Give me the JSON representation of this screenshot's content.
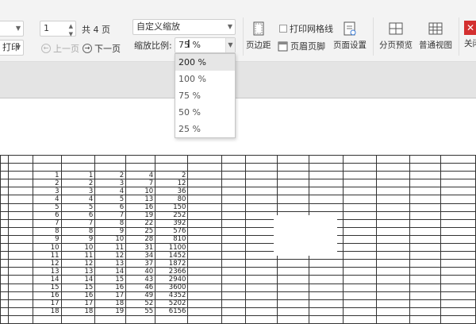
{
  "toolbar": {
    "left_combo": "",
    "print_label": "打印",
    "page_input": "1",
    "page_total": "共 4 页",
    "prev_page": "上一页",
    "next_page": "下一页",
    "zoom_mode": "自定义缩放",
    "zoom_label": "缩放比例:",
    "zoom_value": "75 %",
    "print_gridlines": "打印网格线",
    "buttons": {
      "margins": "页边距",
      "header_footer": "页眉页脚",
      "page_setup": "页面设置",
      "page_break": "分页预览",
      "normal_view": "普通视图",
      "close": "关闭"
    }
  },
  "zoom_dropdown": {
    "options": [
      "200 %",
      "100 %",
      "75 %",
      "50 %",
      "25 %"
    ],
    "highlighted": "200 %"
  },
  "table": {
    "rows": [
      [
        "1",
        "1",
        "2",
        "4",
        "2"
      ],
      [
        "2",
        "2",
        "3",
        "7",
        "12"
      ],
      [
        "3",
        "3",
        "4",
        "10",
        "36"
      ],
      [
        "4",
        "4",
        "5",
        "13",
        "80"
      ],
      [
        "5",
        "5",
        "6",
        "16",
        "150"
      ],
      [
        "6",
        "6",
        "7",
        "19",
        "252"
      ],
      [
        "7",
        "7",
        "8",
        "22",
        "392"
      ],
      [
        "8",
        "8",
        "9",
        "25",
        "576"
      ],
      [
        "9",
        "9",
        "10",
        "28",
        "810"
      ],
      [
        "10",
        "10",
        "11",
        "31",
        "1100"
      ],
      [
        "11",
        "11",
        "12",
        "34",
        "1452"
      ],
      [
        "12",
        "12",
        "13",
        "37",
        "1872"
      ],
      [
        "13",
        "13",
        "14",
        "40",
        "2366"
      ],
      [
        "14",
        "14",
        "15",
        "43",
        "2940"
      ],
      [
        "15",
        "15",
        "16",
        "46",
        "3600"
      ],
      [
        "16",
        "16",
        "17",
        "49",
        "4352"
      ],
      [
        "17",
        "17",
        "18",
        "52",
        "5202"
      ],
      [
        "18",
        "18",
        "19",
        "55",
        "6156"
      ]
    ]
  }
}
